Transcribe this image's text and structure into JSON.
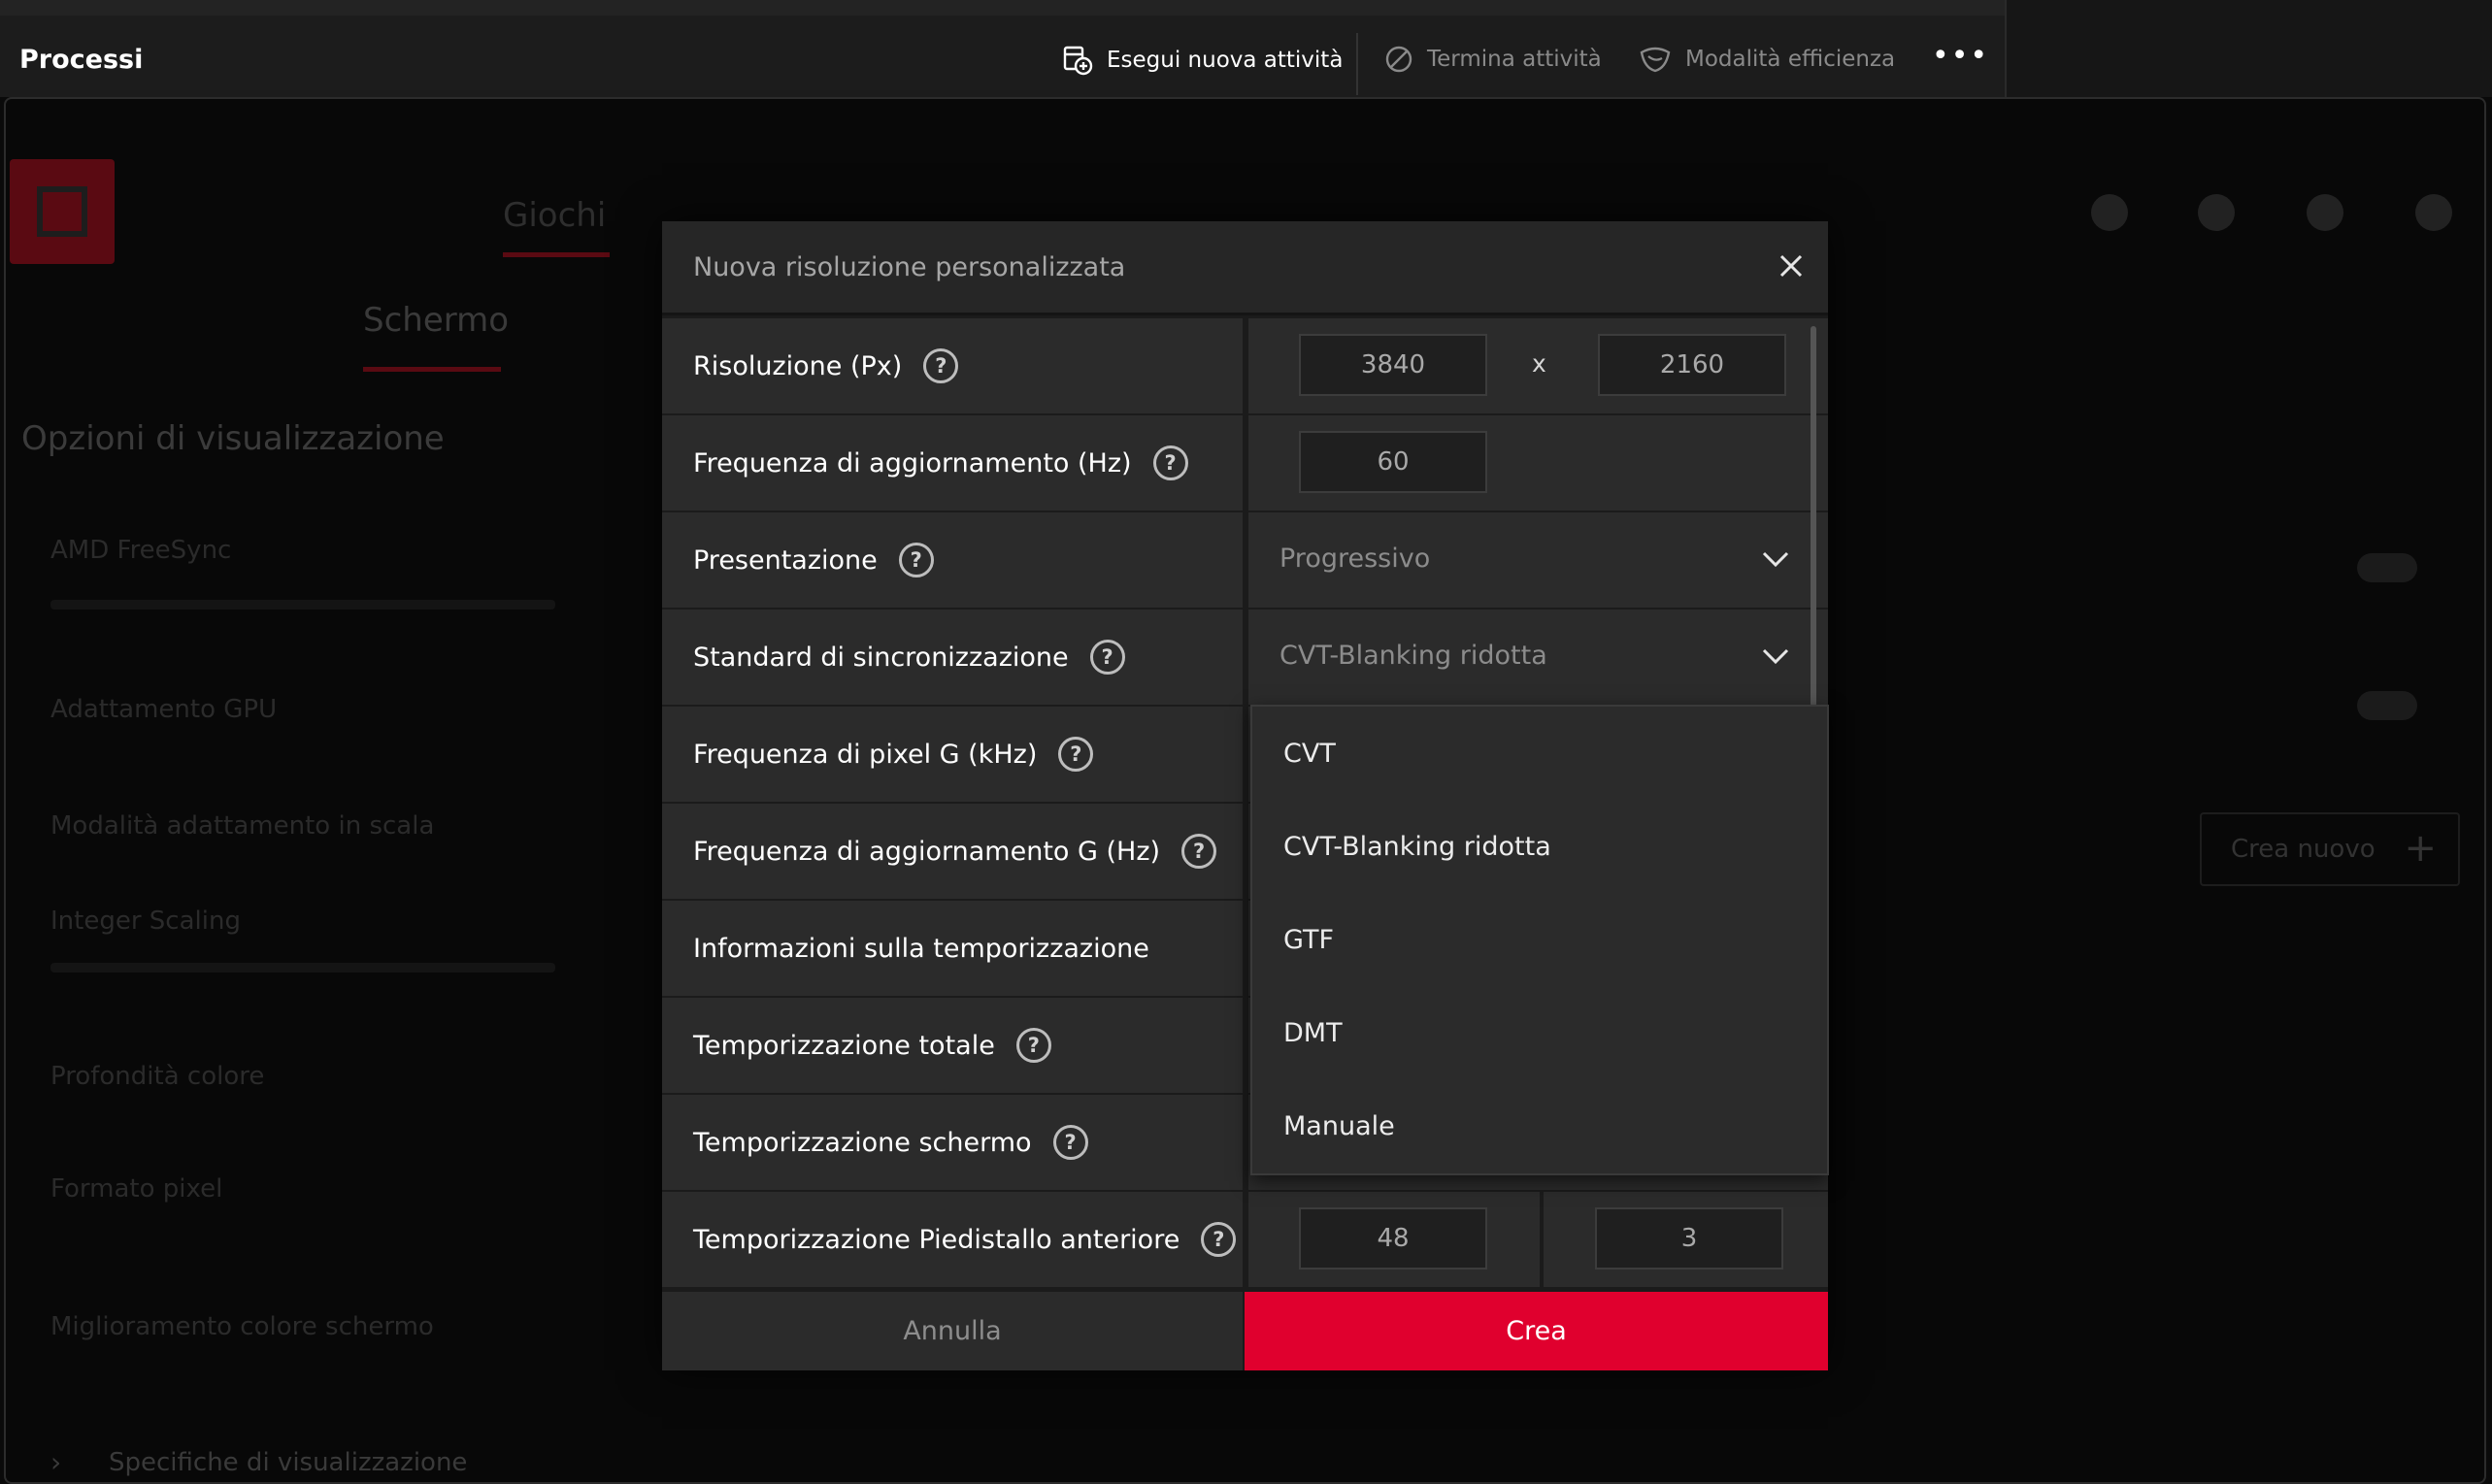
{
  "task_manager": {
    "title": "Processi",
    "run_new_task": "Esegui nuova attività",
    "end_task": "Termina attività",
    "efficiency_mode": "Modalità efficienza",
    "more": "•••"
  },
  "background_app": {
    "tabs": [
      "Giochi",
      "Schermo"
    ],
    "heading": "Opzioni di visualizzazione",
    "rows": [
      "AMD FreeSync",
      "Adattamento GPU",
      "Modalità adattamento in scala",
      "Integer Scaling",
      "Profondità colore",
      "Formato pixel",
      "Miglioramento colore schermo"
    ],
    "create_new": "Crea nuovo",
    "footer_link": "Specifiche di visualizzazione"
  },
  "dialog": {
    "title": "Nuova risoluzione personalizzata",
    "rows": {
      "resolution": {
        "label": "Risoluzione (Px)",
        "width": "3840",
        "height": "2160",
        "separator": "x"
      },
      "refresh": {
        "label": "Frequenza di aggiornamento (Hz)",
        "value": "60"
      },
      "presentation": {
        "label": "Presentazione",
        "value": "Progressivo"
      },
      "sync": {
        "label": "Standard di sincronizzazione",
        "value": "CVT-Blanking ridotta"
      },
      "pixel_freq": {
        "label": "Frequenza di pixel G (kHz)"
      },
      "refresh_g": {
        "label": "Frequenza di aggiornamento G (Hz)"
      },
      "timing_info": {
        "label": "Informazioni sulla temporizzazione"
      },
      "total_timing": {
        "label": "Temporizzazione totale"
      },
      "screen_timing": {
        "label": "Temporizzazione schermo"
      },
      "front_porch": {
        "label": "Temporizzazione Piedistallo anteriore",
        "value1": "48",
        "value2": "3"
      }
    },
    "dropdown_options": [
      "CVT",
      "CVT-Blanking ridotta",
      "GTF",
      "DMT",
      "Manuale"
    ],
    "cancel": "Annulla",
    "create": "Crea"
  },
  "colors": {
    "accent": "#e0002e"
  }
}
